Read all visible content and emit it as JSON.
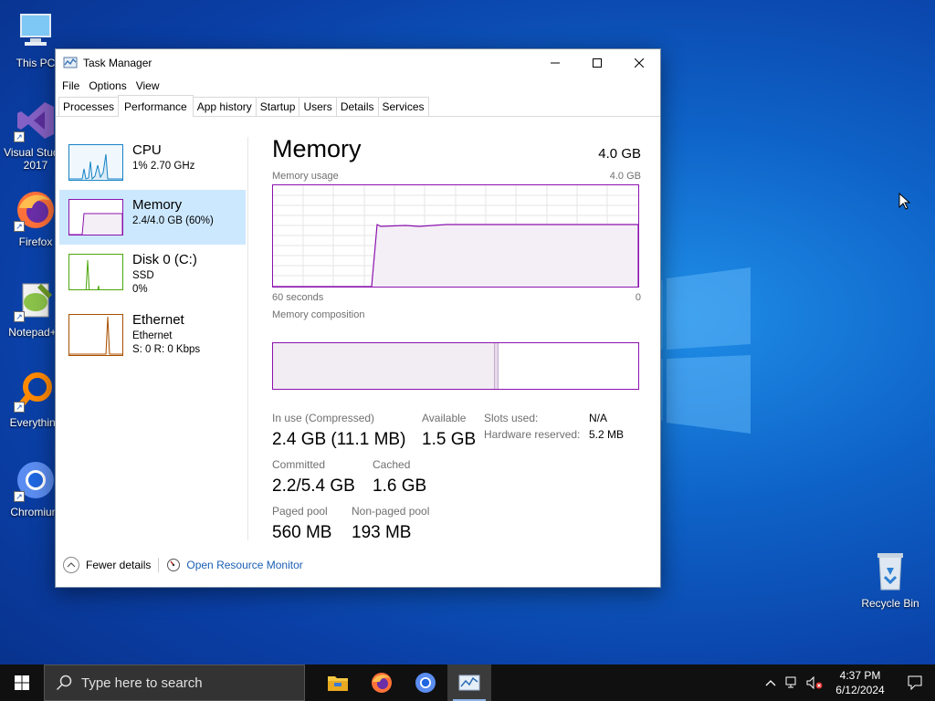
{
  "desktop": {
    "icons": [
      {
        "label": "This PC"
      },
      {
        "label": "Visual Studio 2017"
      },
      {
        "label": "Firefox"
      },
      {
        "label": "Notepad++"
      },
      {
        "label": "Everything"
      },
      {
        "label": "Chromium"
      },
      {
        "label": "Recycle Bin"
      }
    ]
  },
  "window": {
    "title": "Task Manager",
    "menu": [
      "File",
      "Options",
      "View"
    ],
    "tabs": [
      "Processes",
      "Performance",
      "App history",
      "Startup",
      "Users",
      "Details",
      "Services"
    ],
    "active_tab": "Performance"
  },
  "sidebar": [
    {
      "name": "CPU",
      "sub1": "1% 2.70 GHz",
      "sub2": "",
      "sub3": "",
      "color": "#1582c6"
    },
    {
      "name": "Memory",
      "sub1": "2.4/4.0 GB (60%)",
      "sub2": "",
      "sub3": "",
      "color": "#8b12ae",
      "active": true
    },
    {
      "name": "Disk 0 (C:)",
      "sub1": "SSD",
      "sub2": "0%",
      "sub3": "",
      "color": "#4da60c"
    },
    {
      "name": "Ethernet",
      "sub1": "Ethernet",
      "sub2": "S: 0 R: 0 Kbps",
      "sub3": "",
      "color": "#a74f01"
    }
  ],
  "memory": {
    "heading": "Memory",
    "total": "4.0 GB",
    "usage_label": "Memory usage",
    "usage_max": "4.0 GB",
    "time_left": "60 seconds",
    "time_right": "0",
    "composition_label": "Memory composition",
    "in_use_label": "In use (Compressed)",
    "in_use_value": "2.4 GB (11.1 MB)",
    "available_label": "Available",
    "available_value": "1.5 GB",
    "slots_label": "Slots used:",
    "slots_value": "N/A",
    "hw_reserved_label": "Hardware reserved:",
    "hw_reserved_value": "5.2 MB",
    "committed_label": "Committed",
    "committed_value": "2.2/5.4 GB",
    "cached_label": "Cached",
    "cached_value": "1.6 GB",
    "paged_label": "Paged pool",
    "paged_value": "560 MB",
    "nonpaged_label": "Non-paged pool",
    "nonpaged_value": "193 MB",
    "usage_fraction": 0.6,
    "accent": "#8b12ae"
  },
  "footer": {
    "fewer_details": "Fewer details",
    "open_resource_monitor": "Open Resource Monitor"
  },
  "taskbar": {
    "search_placeholder": "Type here to search",
    "time": "4:37 PM",
    "date": "6/12/2024"
  }
}
